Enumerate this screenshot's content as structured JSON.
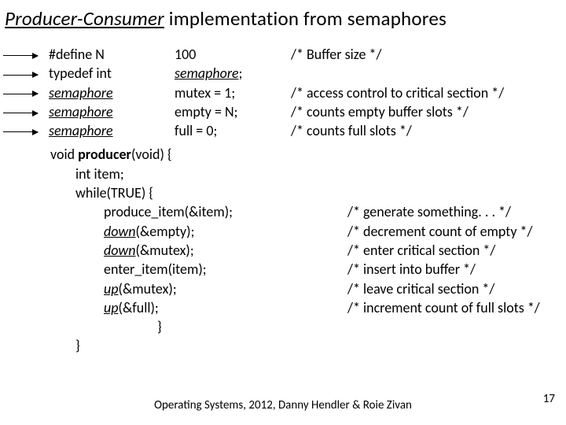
{
  "title": {
    "em": "Producer-Consumer",
    "rest": " implementation from semaphores"
  },
  "decl": [
    {
      "c1a": "#define   N",
      "c1b": "",
      "c2": "100",
      "c3": "/* Buffer size */"
    },
    {
      "c1a": "typedef   int",
      "c1b": "",
      "c2_sema": "semaphore",
      "c2_tail": ";",
      "c3": ""
    },
    {
      "c1_sema": "semaphore",
      "c2": "mutex = 1;",
      "c3": "/* access control to critical section */"
    },
    {
      "c1_sema": "semaphore",
      "c2": "empty = N;",
      "c3": "/* counts empty buffer slots */"
    },
    {
      "c1_sema": "semaphore",
      "c2": "full = 0;",
      "c3": "/* counts full slots */"
    }
  ],
  "func": {
    "sig_pre": "void ",
    "sig_name": "producer",
    "sig_post": "(void)  {",
    "l1": "int     item;",
    "l2": "while(TRUE) {",
    "body": [
      {
        "pre": "produce_item(&item);",
        "cmt": "/* generate something. . . */"
      },
      {
        "em": "down",
        "post": "(&empty);",
        "cmt": "/* decrement count of empty */"
      },
      {
        "em": "down",
        "post": "(&mutex);",
        "cmt": "/* enter critical section */"
      },
      {
        "pre": "enter_item(item);",
        "cmt": "/* insert into buffer */"
      },
      {
        "em": "up",
        "post": "(&mutex);",
        "cmt": "/* leave critical section */"
      },
      {
        "em": "up",
        "post": "(&full);",
        "cmt": "/* increment count of full slots */"
      }
    ],
    "close_inner": "}",
    "close_outer": "}"
  },
  "footer": "Operating Systems, 2012,  Danny Hendler & Roie Zivan",
  "pagenum": "17"
}
